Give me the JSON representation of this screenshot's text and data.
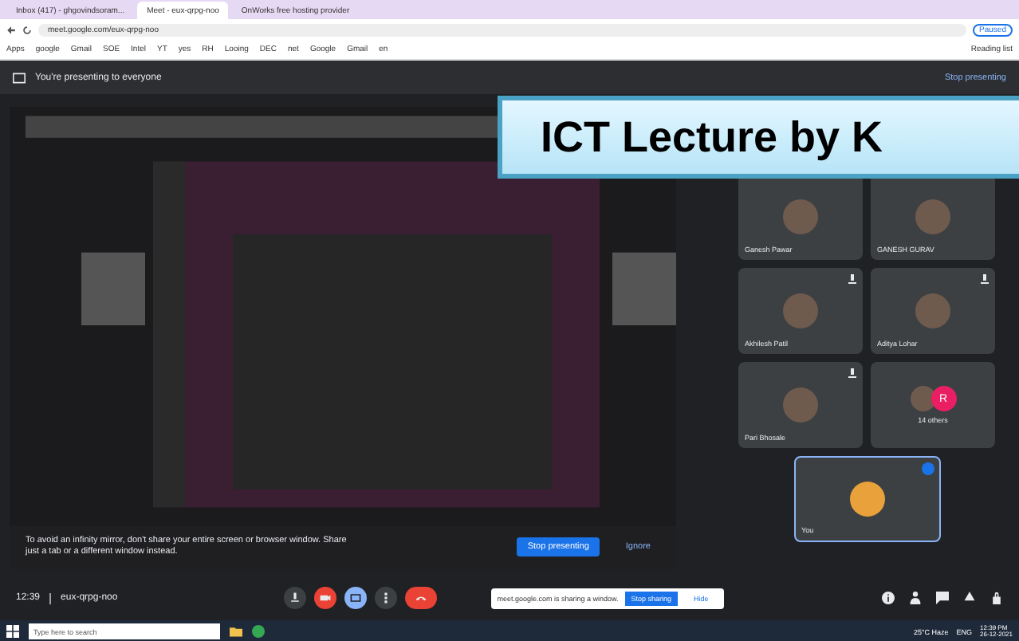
{
  "browser": {
    "tabs": [
      {
        "title": "Inbox (417) - ghgovindsoram...",
        "selected": false
      },
      {
        "title": "Meet - eux-qrpg-noo",
        "selected": true
      },
      {
        "title": "OnWorks free hosting provider",
        "selected": false
      }
    ],
    "url": "meet.google.com/eux-qrpg-noo",
    "profile": "Paused",
    "bookmarks": [
      "Apps",
      "google",
      "Gmail",
      "SOE",
      "Intel",
      "YT",
      "yes",
      "RH",
      "Looing",
      "DEC",
      "net",
      "Google",
      "Gmail",
      "en"
    ],
    "reading_list": "Reading list"
  },
  "presenting_bar": {
    "message": "You're presenting to everyone",
    "action": "Stop presenting"
  },
  "banner": {
    "title": "ICT Lecture by K"
  },
  "participants": [
    {
      "name": "Ganesh Pawar",
      "muted": false
    },
    {
      "name": "GANESH GURAV",
      "muted": false
    },
    {
      "name": "Akhilesh Patil",
      "muted": true
    },
    {
      "name": "Aditya Lohar",
      "muted": true
    },
    {
      "name": "Pari Bhosale",
      "muted": true
    }
  ],
  "others": {
    "label": "14 others",
    "initial": "R"
  },
  "self_tile": {
    "label": "You"
  },
  "warning": {
    "text": "To avoid an infinity mirror, don't share your entire screen or browser window. Share just a tab or a different window instead.",
    "primary": "Stop presenting",
    "secondary": "Ignore"
  },
  "meeting": {
    "time": "12:39",
    "code": "eux-qrpg-noo"
  },
  "sharing_bar": {
    "text": "meet.google.com is sharing a window.",
    "primary": "Stop sharing",
    "secondary": "Hide"
  },
  "taskbar": {
    "search_placeholder": "Type here to search",
    "weather": "25°C Haze",
    "language": "ENG",
    "time": "12:39 PM",
    "date": "26-12-2021"
  }
}
